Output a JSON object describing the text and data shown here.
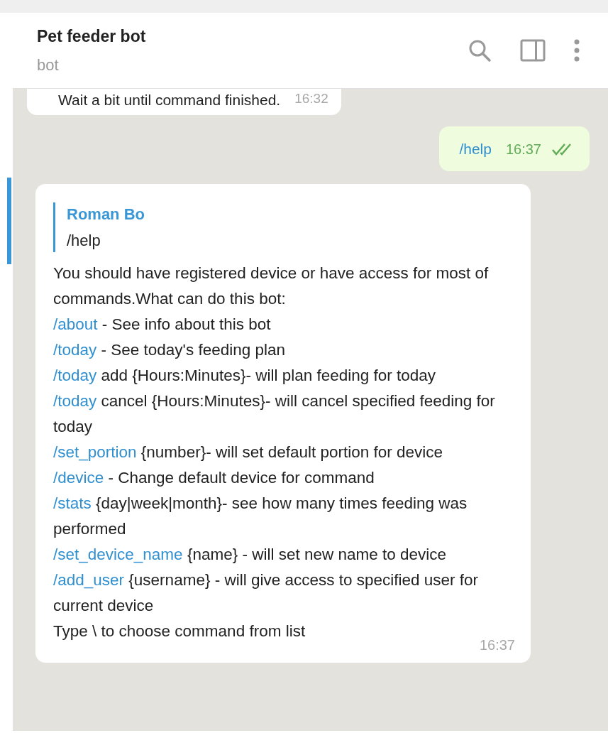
{
  "header": {
    "title": "Pet feeder bot",
    "subtitle": "bot"
  },
  "messages": [
    {
      "kind": "incoming",
      "text": "Wait a bit until command finished.",
      "time": "16:32"
    },
    {
      "kind": "outgoing",
      "command": "/help",
      "time": "16:37",
      "read": true
    },
    {
      "kind": "reply",
      "selected": true,
      "quote": {
        "author": "Roman Bo",
        "text": "/help"
      },
      "time": "16:37",
      "lines": [
        {
          "text": "You should have registered device or have access for most of commands.What can do this bot:"
        },
        {
          "command": "/about",
          "text": " - See info about this bot"
        },
        {
          "command": "/today",
          "text": " - See today's feeding plan"
        },
        {
          "command": "/today",
          "text": " add {Hours:Minutes}- will plan feeding for today"
        },
        {
          "command": "/today",
          "text": " cancel {Hours:Minutes}- will cancel specified feeding for today"
        },
        {
          "command": "/set_portion",
          "text": " {number}- will set default portion for device"
        },
        {
          "command": "/device",
          "text": " - Change default device for command"
        },
        {
          "command": "/stats",
          "text": " {day|week|month}- see how many times feeding was performed"
        },
        {
          "command": "/set_device_name",
          "text": " {name} - will set new name to device"
        },
        {
          "command": "/add_user",
          "text": " {username} - will give access to specified user for current device"
        },
        {
          "text": "Type \\ to choose command from list"
        }
      ]
    }
  ]
}
